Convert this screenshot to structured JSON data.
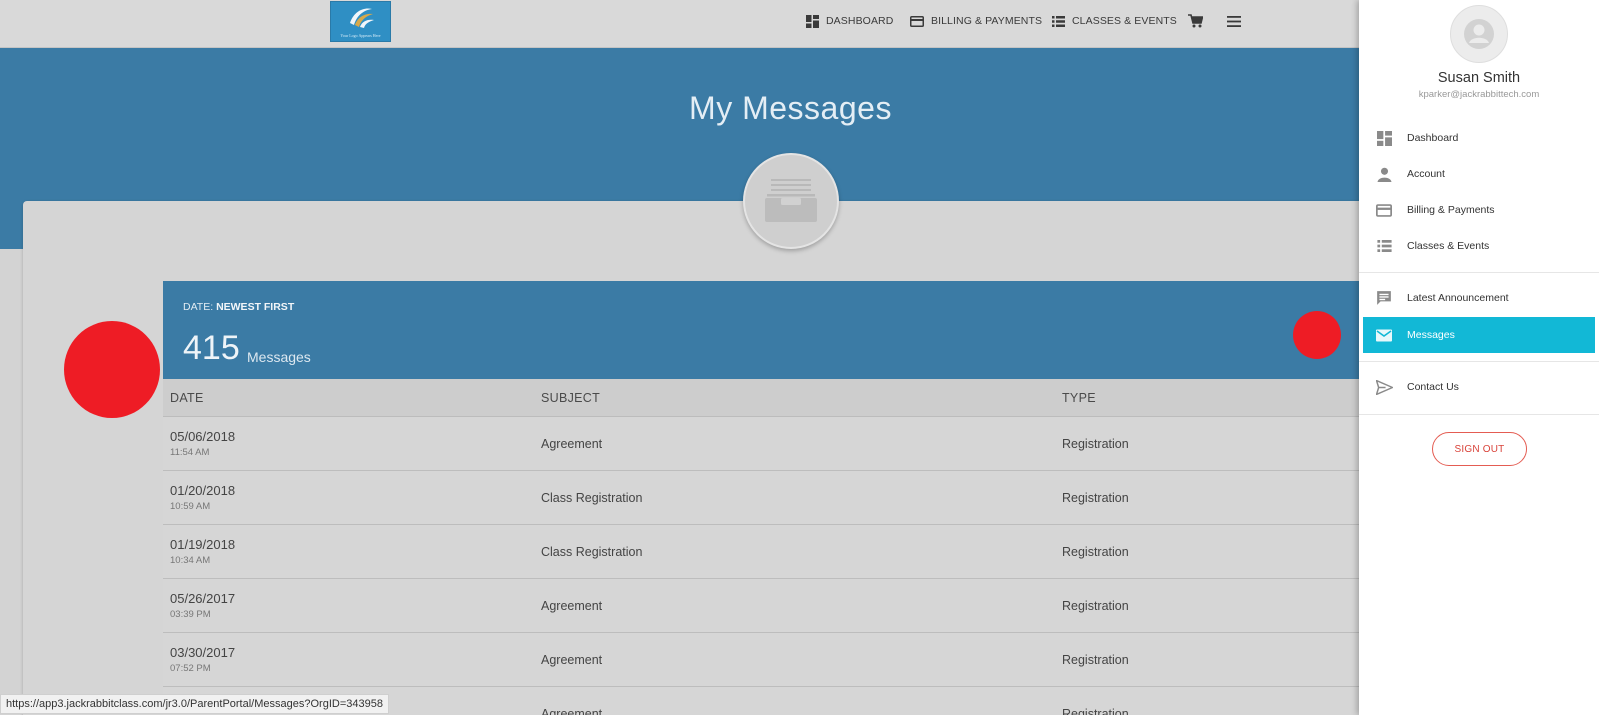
{
  "nav": {
    "logo_text": "Your Logo Appears Here",
    "dashboard": "DASHBOARD",
    "billing": "BILLING & PAYMENTS",
    "classes": "CLASSES & EVENTS"
  },
  "page": {
    "title": "My Messages"
  },
  "list": {
    "sort_prefix": "DATE: ",
    "sort_value": "NEWEST FIRST",
    "count": "415",
    "count_label": "Messages",
    "columns": {
      "date": "DATE",
      "subject": "SUBJECT",
      "type": "TYPE"
    },
    "rows": [
      {
        "date": "05/06/2018",
        "time": "11:54 AM",
        "subject": "Agreement",
        "type": "Registration"
      },
      {
        "date": "01/20/2018",
        "time": "10:59 AM",
        "subject": "Class Registration",
        "type": "Registration"
      },
      {
        "date": "01/19/2018",
        "time": "10:34 AM",
        "subject": "Class Registration",
        "type": "Registration"
      },
      {
        "date": "05/26/2017",
        "time": "03:39 PM",
        "subject": "Agreement",
        "type": "Registration"
      },
      {
        "date": "03/30/2017",
        "time": "07:52 PM",
        "subject": "Agreement",
        "type": "Registration"
      },
      {
        "date": "",
        "time": "",
        "subject": "Agreement",
        "type": "Registration"
      }
    ]
  },
  "status_url": "https://app3.jackrabbitclass.com/jr3.0/ParentPortal/Messages?OrgID=343958",
  "drawer": {
    "user_name": "Susan Smith",
    "user_email": "kparker@jackrabbittech.com",
    "items": [
      {
        "label": "Dashboard",
        "icon": "dashboard-icon"
      },
      {
        "label": "Account",
        "icon": "person-icon"
      },
      {
        "label": "Billing & Payments",
        "icon": "credit-card-icon"
      },
      {
        "label": "Classes & Events",
        "icon": "list-icon"
      },
      {
        "label": "Latest Announcement",
        "icon": "announcement-icon"
      },
      {
        "label": "Messages",
        "icon": "mail-icon"
      },
      {
        "label": "Contact Us",
        "icon": "send-icon"
      }
    ],
    "sign_out": "SIGN OUT"
  },
  "colors": {
    "banner_blue": "#3b7ba5",
    "active_cyan": "#12b8d6",
    "marker_red": "#ee1c25",
    "signout_red": "#d9433a"
  }
}
